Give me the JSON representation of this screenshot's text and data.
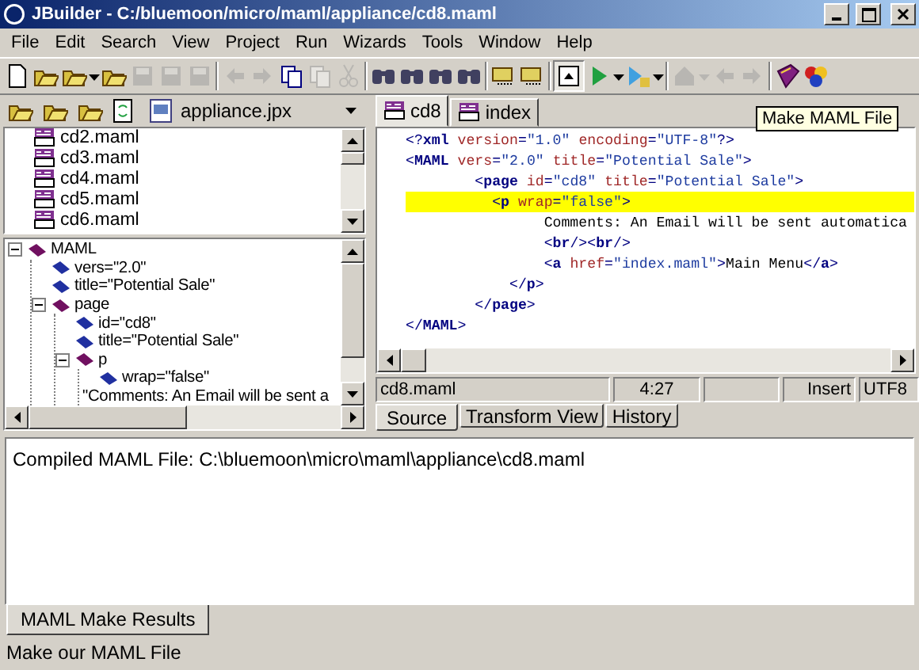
{
  "window": {
    "title": "JBuilder - C:/bluemoon/micro/maml/appliance/cd8.maml"
  },
  "menu": [
    "File",
    "Edit",
    "Search",
    "View",
    "Project",
    "Run",
    "Wizards",
    "Tools",
    "Window",
    "Help"
  ],
  "toolbar": [
    {
      "kind": "new",
      "disabled": false
    },
    {
      "kind": "open",
      "disabled": false
    },
    {
      "kind": "reopen",
      "disabled": false
    },
    {
      "kind": "dropdown",
      "disabled": false
    },
    {
      "kind": "close",
      "disabled": false
    },
    {
      "kind": "save",
      "disabled": true
    },
    {
      "kind": "saveall",
      "disabled": true
    },
    {
      "kind": "print",
      "disabled": true
    },
    {
      "kind": "sep"
    },
    {
      "kind": "undo",
      "disabled": true
    },
    {
      "kind": "redo",
      "disabled": true
    },
    {
      "kind": "copy",
      "disabled": false
    },
    {
      "kind": "paste",
      "disabled": true
    },
    {
      "kind": "cut",
      "disabled": true
    },
    {
      "kind": "sep"
    },
    {
      "kind": "find",
      "disabled": false
    },
    {
      "kind": "findagain",
      "disabled": false
    },
    {
      "kind": "replace",
      "disabled": false
    },
    {
      "kind": "searchclass",
      "disabled": false
    },
    {
      "kind": "sep"
    },
    {
      "kind": "make",
      "disabled": false
    },
    {
      "kind": "rebuild",
      "disabled": false
    },
    {
      "kind": "sep"
    },
    {
      "kind": "toggle",
      "disabled": false
    },
    {
      "kind": "run",
      "disabled": false
    },
    {
      "kind": "dropdown",
      "disabled": false
    },
    {
      "kind": "debug",
      "disabled": false
    },
    {
      "kind": "dropdown",
      "disabled": false
    },
    {
      "kind": "sep"
    },
    {
      "kind": "home",
      "disabled": true
    },
    {
      "kind": "dropdown",
      "disabled": true
    },
    {
      "kind": "back",
      "disabled": true
    },
    {
      "kind": "forward",
      "disabled": true
    },
    {
      "kind": "sep"
    },
    {
      "kind": "book",
      "disabled": false
    },
    {
      "kind": "palette",
      "disabled": false
    }
  ],
  "project_toolbar": {
    "project": "appliance.jpx"
  },
  "files": [
    "cd2.maml",
    "cd3.maml",
    "cd4.maml",
    "cd5.maml",
    "cd6.maml"
  ],
  "structure": [
    {
      "label": "MAML",
      "kind": "element",
      "expanded": true,
      "children": [
        {
          "label": "vers=\"2.0\"",
          "kind": "attribute"
        },
        {
          "label": "title=\"Potential Sale\"",
          "kind": "attribute"
        },
        {
          "label": "page",
          "kind": "element",
          "expanded": true,
          "children": [
            {
              "label": "id=\"cd8\"",
              "kind": "attribute"
            },
            {
              "label": "title=\"Potential Sale\"",
              "kind": "attribute"
            },
            {
              "label": "p",
              "kind": "element",
              "expanded": true,
              "children": [
                {
                  "label": "wrap=\"false\"",
                  "kind": "attribute"
                },
                {
                  "label": "\"Comments: An Email will be sent a",
                  "kind": "text"
                }
              ]
            }
          ]
        }
      ]
    }
  ],
  "editor_tabs": [
    {
      "label": "cd8",
      "selected": true
    },
    {
      "label": "index",
      "selected": false
    }
  ],
  "tooltip": "Make MAML File",
  "code": [
    {
      "highlighted": false,
      "tokens": [
        {
          "kind": "punct",
          "text": "<?"
        },
        {
          "kind": "tag",
          "text": "xml"
        },
        {
          "kind": "attr",
          "text": " version"
        },
        {
          "kind": "punct",
          "text": "="
        },
        {
          "kind": "value",
          "text": "\"1.0\""
        },
        {
          "kind": "attr",
          "text": " encoding"
        },
        {
          "kind": "punct",
          "text": "="
        },
        {
          "kind": "value",
          "text": "\"UTF-8\""
        },
        {
          "kind": "punct",
          "text": "?>"
        }
      ]
    },
    {
      "highlighted": false,
      "tokens": [
        {
          "kind": "punct",
          "text": "<"
        },
        {
          "kind": "tag",
          "text": "MAML"
        },
        {
          "kind": "attr",
          "text": " vers"
        },
        {
          "kind": "punct",
          "text": "="
        },
        {
          "kind": "value",
          "text": "\"2.0\""
        },
        {
          "kind": "attr",
          "text": " title"
        },
        {
          "kind": "punct",
          "text": "="
        },
        {
          "kind": "value",
          "text": "\"Potential Sale\""
        },
        {
          "kind": "punct",
          "text": ">"
        }
      ]
    },
    {
      "highlighted": false,
      "tokens": [
        {
          "kind": "punct",
          "text": "        <"
        },
        {
          "kind": "tag",
          "text": "page"
        },
        {
          "kind": "attr",
          "text": " id"
        },
        {
          "kind": "punct",
          "text": "="
        },
        {
          "kind": "value",
          "text": "\"cd8\""
        },
        {
          "kind": "attr",
          "text": " title"
        },
        {
          "kind": "punct",
          "text": "="
        },
        {
          "kind": "value",
          "text": "\"Potential Sale\""
        },
        {
          "kind": "punct",
          "text": ">"
        }
      ]
    },
    {
      "highlighted": true,
      "tokens": [
        {
          "kind": "punct",
          "text": "          <"
        },
        {
          "kind": "tag",
          "text": "p"
        },
        {
          "kind": "attr",
          "text": " wrap"
        },
        {
          "kind": "punct",
          "text": "="
        },
        {
          "kind": "value",
          "text": "\"false\""
        },
        {
          "kind": "punct",
          "text": ">"
        }
      ]
    },
    {
      "highlighted": false,
      "tokens": [
        {
          "kind": "text",
          "text": "                Comments: An Email will be sent automatica"
        }
      ]
    },
    {
      "highlighted": false,
      "tokens": [
        {
          "kind": "punct",
          "text": "                <"
        },
        {
          "kind": "tag",
          "text": "br"
        },
        {
          "kind": "punct",
          "text": "/><"
        },
        {
          "kind": "tag",
          "text": "br"
        },
        {
          "kind": "punct",
          "text": "/>"
        }
      ]
    },
    {
      "highlighted": false,
      "tokens": [
        {
          "kind": "punct",
          "text": "                <"
        },
        {
          "kind": "tag",
          "text": "a"
        },
        {
          "kind": "attr",
          "text": " href"
        },
        {
          "kind": "punct",
          "text": "="
        },
        {
          "kind": "value",
          "text": "\"index.maml\""
        },
        {
          "kind": "punct",
          "text": ">"
        },
        {
          "kind": "text",
          "text": "Main Menu"
        },
        {
          "kind": "punct",
          "text": "</"
        },
        {
          "kind": "tag",
          "text": "a"
        },
        {
          "kind": "punct",
          "text": ">"
        }
      ]
    },
    {
      "highlighted": false,
      "tokens": [
        {
          "kind": "punct",
          "text": "            </"
        },
        {
          "kind": "tag",
          "text": "p"
        },
        {
          "kind": "punct",
          "text": ">"
        }
      ]
    },
    {
      "highlighted": false,
      "tokens": [
        {
          "kind": "punct",
          "text": "        </"
        },
        {
          "kind": "tag",
          "text": "page"
        },
        {
          "kind": "punct",
          "text": ">"
        }
      ]
    },
    {
      "highlighted": false,
      "tokens": [
        {
          "kind": "punct",
          "text": "</"
        },
        {
          "kind": "tag",
          "text": "MAML"
        },
        {
          "kind": "punct",
          "text": ">"
        }
      ]
    }
  ],
  "editor_status": {
    "file": "cd8.maml",
    "position": "4:27",
    "mode": "Insert",
    "encoding": "UTF8"
  },
  "view_tabs": [
    {
      "label": "Source",
      "selected": true
    },
    {
      "label": "Transform View",
      "selected": false
    },
    {
      "label": "History",
      "selected": false
    }
  ],
  "messages": {
    "lines": [
      "Compiled MAML File: C:\\bluemoon\\micro\\maml\\appliance\\cd8.maml"
    ],
    "tabs": [
      {
        "label": "MAML Make Results",
        "selected": true
      }
    ]
  },
  "status_bar": "Make our MAML File"
}
